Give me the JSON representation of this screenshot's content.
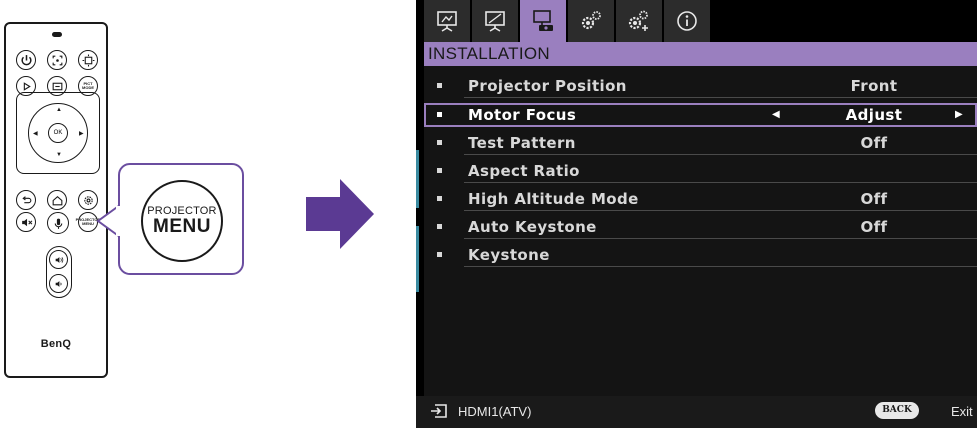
{
  "remote": {
    "brand": "BenQ",
    "keys": {
      "power": "⏻",
      "source": "⇥",
      "preset": "PICT MODE",
      "menu_small": "PROJECTOR MENU",
      "ok": "OK"
    }
  },
  "callout": {
    "line1": "PROJECTOR",
    "line2": "MENU",
    "border_color": "#6b4ea0"
  },
  "arrow_color": "#5b3a93",
  "osd": {
    "tabs": [
      {
        "icon": "display-icon"
      },
      {
        "icon": "picture-icon"
      },
      {
        "icon": "installation-icon",
        "active": true
      },
      {
        "icon": "settings-basic-icon"
      },
      {
        "icon": "settings-advanced-icon"
      },
      {
        "icon": "info-icon"
      }
    ],
    "title": "INSTALLATION",
    "accent_color": "#9a7fbf",
    "items": [
      {
        "label": "Projector Position",
        "value": "Front"
      },
      {
        "label": "Motor Focus",
        "value": "Adjust",
        "selected": true
      },
      {
        "label": "Test Pattern",
        "value": "Off"
      },
      {
        "label": "Aspect Ratio",
        "value": ""
      },
      {
        "label": "High Altitude Mode",
        "value": "Off"
      },
      {
        "label": "Auto Keystone",
        "value": "Off"
      },
      {
        "label": "Keystone",
        "value": ""
      }
    ],
    "footer": {
      "source": "HDMI1(ATV)",
      "back_label": "BACK",
      "exit_label": "Exit"
    }
  }
}
